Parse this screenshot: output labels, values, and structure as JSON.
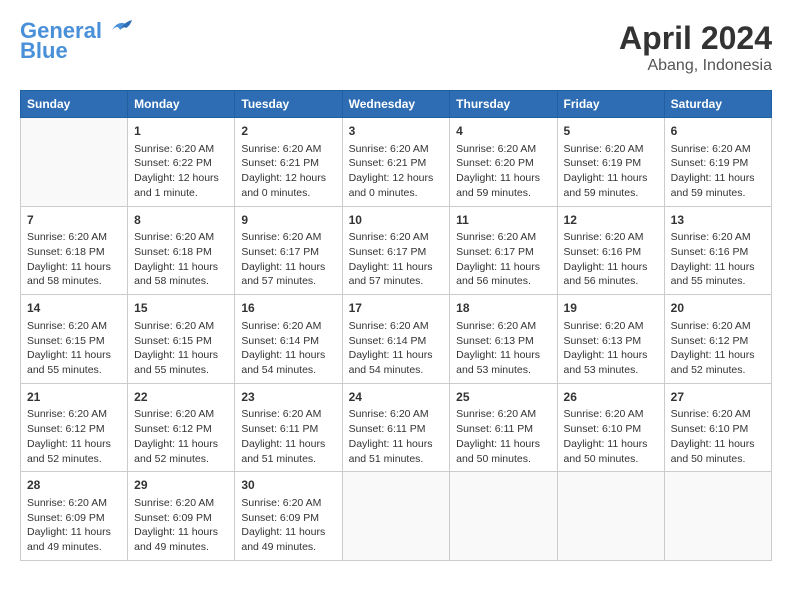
{
  "logo": {
    "line1": "General",
    "line2": "Blue"
  },
  "title": "April 2024",
  "subtitle": "Abang, Indonesia",
  "weekdays": [
    "Sunday",
    "Monday",
    "Tuesday",
    "Wednesday",
    "Thursday",
    "Friday",
    "Saturday"
  ],
  "weeks": [
    [
      {
        "day": "",
        "content": ""
      },
      {
        "day": "1",
        "content": "Sunrise: 6:20 AM\nSunset: 6:22 PM\nDaylight: 12 hours\nand 1 minute."
      },
      {
        "day": "2",
        "content": "Sunrise: 6:20 AM\nSunset: 6:21 PM\nDaylight: 12 hours\nand 0 minutes."
      },
      {
        "day": "3",
        "content": "Sunrise: 6:20 AM\nSunset: 6:21 PM\nDaylight: 12 hours\nand 0 minutes."
      },
      {
        "day": "4",
        "content": "Sunrise: 6:20 AM\nSunset: 6:20 PM\nDaylight: 11 hours\nand 59 minutes."
      },
      {
        "day": "5",
        "content": "Sunrise: 6:20 AM\nSunset: 6:19 PM\nDaylight: 11 hours\nand 59 minutes."
      },
      {
        "day": "6",
        "content": "Sunrise: 6:20 AM\nSunset: 6:19 PM\nDaylight: 11 hours\nand 59 minutes."
      }
    ],
    [
      {
        "day": "7",
        "content": "Sunrise: 6:20 AM\nSunset: 6:18 PM\nDaylight: 11 hours\nand 58 minutes."
      },
      {
        "day": "8",
        "content": "Sunrise: 6:20 AM\nSunset: 6:18 PM\nDaylight: 11 hours\nand 58 minutes."
      },
      {
        "day": "9",
        "content": "Sunrise: 6:20 AM\nSunset: 6:17 PM\nDaylight: 11 hours\nand 57 minutes."
      },
      {
        "day": "10",
        "content": "Sunrise: 6:20 AM\nSunset: 6:17 PM\nDaylight: 11 hours\nand 57 minutes."
      },
      {
        "day": "11",
        "content": "Sunrise: 6:20 AM\nSunset: 6:17 PM\nDaylight: 11 hours\nand 56 minutes."
      },
      {
        "day": "12",
        "content": "Sunrise: 6:20 AM\nSunset: 6:16 PM\nDaylight: 11 hours\nand 56 minutes."
      },
      {
        "day": "13",
        "content": "Sunrise: 6:20 AM\nSunset: 6:16 PM\nDaylight: 11 hours\nand 55 minutes."
      }
    ],
    [
      {
        "day": "14",
        "content": "Sunrise: 6:20 AM\nSunset: 6:15 PM\nDaylight: 11 hours\nand 55 minutes."
      },
      {
        "day": "15",
        "content": "Sunrise: 6:20 AM\nSunset: 6:15 PM\nDaylight: 11 hours\nand 55 minutes."
      },
      {
        "day": "16",
        "content": "Sunrise: 6:20 AM\nSunset: 6:14 PM\nDaylight: 11 hours\nand 54 minutes."
      },
      {
        "day": "17",
        "content": "Sunrise: 6:20 AM\nSunset: 6:14 PM\nDaylight: 11 hours\nand 54 minutes."
      },
      {
        "day": "18",
        "content": "Sunrise: 6:20 AM\nSunset: 6:13 PM\nDaylight: 11 hours\nand 53 minutes."
      },
      {
        "day": "19",
        "content": "Sunrise: 6:20 AM\nSunset: 6:13 PM\nDaylight: 11 hours\nand 53 minutes."
      },
      {
        "day": "20",
        "content": "Sunrise: 6:20 AM\nSunset: 6:12 PM\nDaylight: 11 hours\nand 52 minutes."
      }
    ],
    [
      {
        "day": "21",
        "content": "Sunrise: 6:20 AM\nSunset: 6:12 PM\nDaylight: 11 hours\nand 52 minutes."
      },
      {
        "day": "22",
        "content": "Sunrise: 6:20 AM\nSunset: 6:12 PM\nDaylight: 11 hours\nand 52 minutes."
      },
      {
        "day": "23",
        "content": "Sunrise: 6:20 AM\nSunset: 6:11 PM\nDaylight: 11 hours\nand 51 minutes."
      },
      {
        "day": "24",
        "content": "Sunrise: 6:20 AM\nSunset: 6:11 PM\nDaylight: 11 hours\nand 51 minutes."
      },
      {
        "day": "25",
        "content": "Sunrise: 6:20 AM\nSunset: 6:11 PM\nDaylight: 11 hours\nand 50 minutes."
      },
      {
        "day": "26",
        "content": "Sunrise: 6:20 AM\nSunset: 6:10 PM\nDaylight: 11 hours\nand 50 minutes."
      },
      {
        "day": "27",
        "content": "Sunrise: 6:20 AM\nSunset: 6:10 PM\nDaylight: 11 hours\nand 50 minutes."
      }
    ],
    [
      {
        "day": "28",
        "content": "Sunrise: 6:20 AM\nSunset: 6:09 PM\nDaylight: 11 hours\nand 49 minutes."
      },
      {
        "day": "29",
        "content": "Sunrise: 6:20 AM\nSunset: 6:09 PM\nDaylight: 11 hours\nand 49 minutes."
      },
      {
        "day": "30",
        "content": "Sunrise: 6:20 AM\nSunset: 6:09 PM\nDaylight: 11 hours\nand 49 minutes."
      },
      {
        "day": "",
        "content": ""
      },
      {
        "day": "",
        "content": ""
      },
      {
        "day": "",
        "content": ""
      },
      {
        "day": "",
        "content": ""
      }
    ]
  ]
}
